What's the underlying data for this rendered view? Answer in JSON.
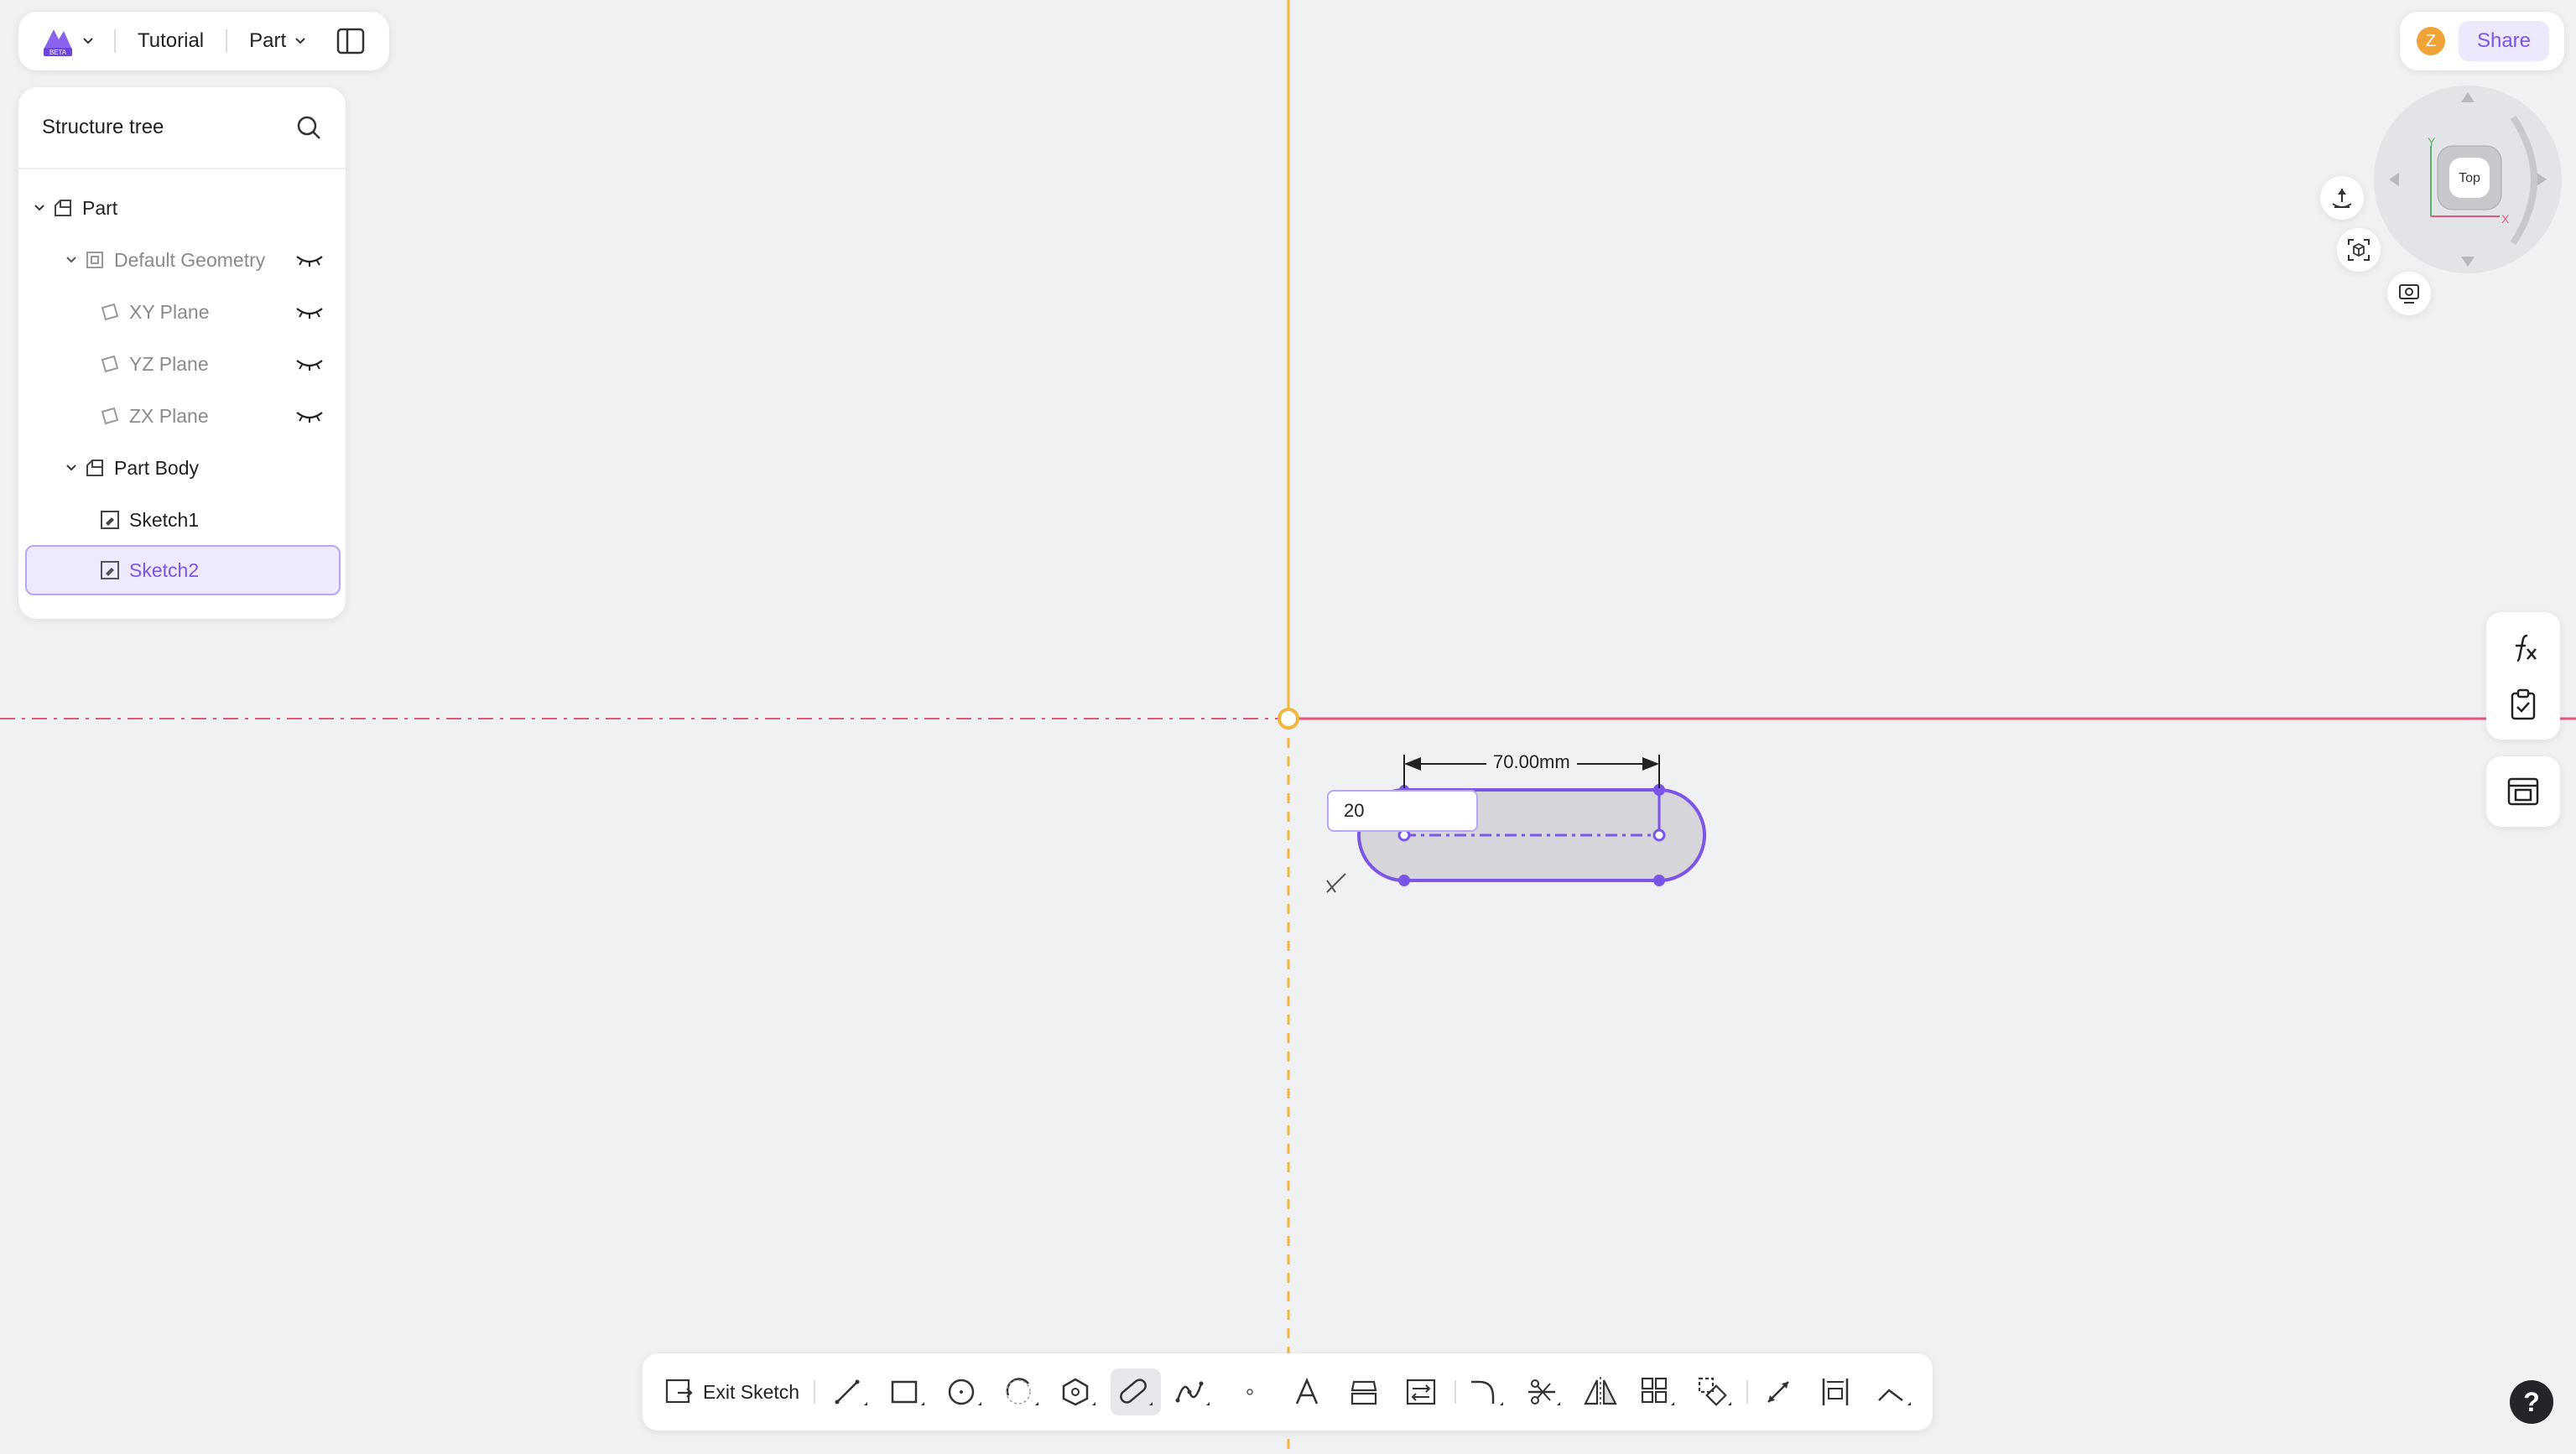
{
  "topbar": {
    "tutorial_label": "Tutorial",
    "part_label": "Part",
    "logo_badge": "BETA"
  },
  "tree": {
    "title": "Structure tree",
    "items": [
      {
        "label": "Part"
      },
      {
        "label": "Default Geometry"
      },
      {
        "label": "XY Plane"
      },
      {
        "label": "YZ Plane"
      },
      {
        "label": "ZX Plane"
      },
      {
        "label": "Part Body"
      },
      {
        "label": "Sketch1"
      },
      {
        "label": "Sketch2"
      }
    ]
  },
  "topright": {
    "avatar_letter": "Z",
    "share_label": "Share"
  },
  "viewcube": {
    "face_label": "Top",
    "axis_x": "X",
    "axis_y": "Y"
  },
  "sketch": {
    "dimension_label": "70.00mm",
    "input_value": "20"
  },
  "toolbar": {
    "exit_label": "Exit Sketch"
  },
  "help": {
    "label": "?"
  },
  "colors": {
    "accent": "#7b54e8",
    "vertical_axis": "#f2b63c",
    "horizontal_axis": "#e2587a",
    "selection_bg": "#eee9fc"
  }
}
